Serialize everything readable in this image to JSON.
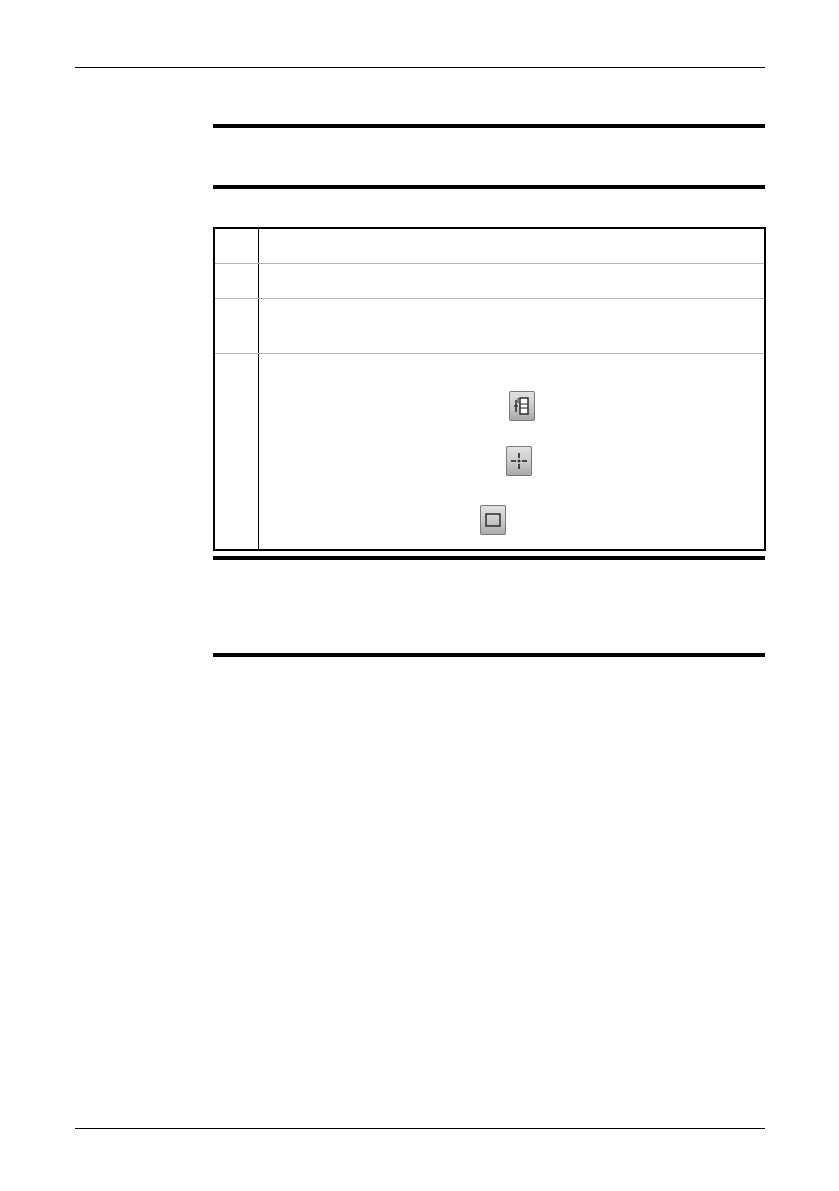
{
  "page": {
    "header_text": "",
    "footer_text": ""
  },
  "procedure": {
    "icons": [
      "line-measurement-icon",
      "spot-measurement-icon",
      "area-measurement-icon"
    ]
  }
}
